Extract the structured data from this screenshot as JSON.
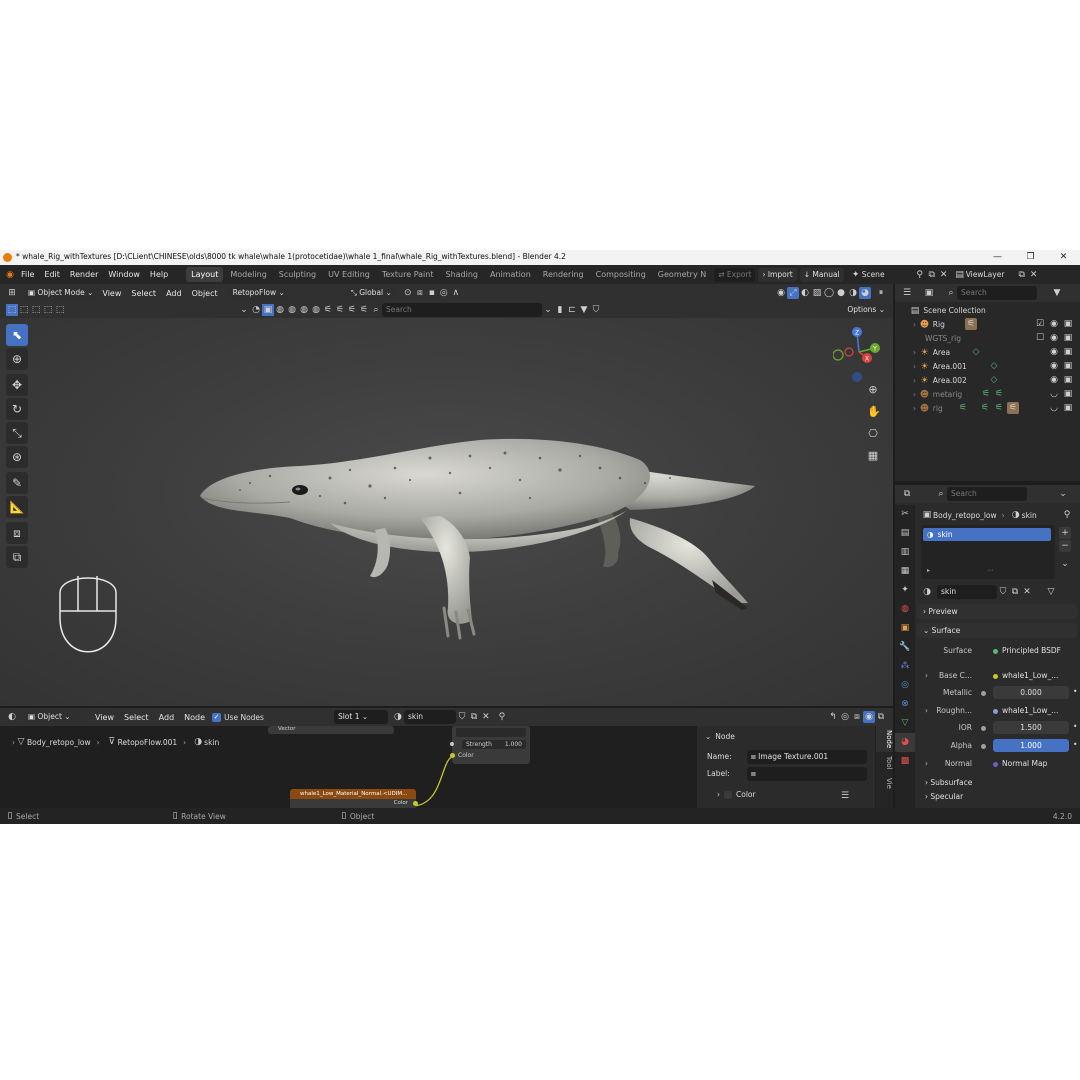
{
  "titlebar": {
    "title": "* whale_Rig_withTextures [D:\\CLient\\CHINESE\\olds\\8000 tk whale\\whale 1(protocetidae)\\whale 1_final\\whale_Rig_withTextures.blend] - Blender 4.2",
    "minimize": "—",
    "maximize": "❐",
    "close": "✕"
  },
  "menu": [
    "File",
    "Edit",
    "Render",
    "Window",
    "Help"
  ],
  "workspaces": [
    "Layout",
    "Modeling",
    "Sculpting",
    "UV Editing",
    "Texture Paint",
    "Shading",
    "Animation",
    "Rendering",
    "Compositing",
    "Geometry N"
  ],
  "topright": {
    "export": "Export",
    "import": "Import",
    "manual": "Manual",
    "scene": "Scene",
    "viewlayer": "ViewLayer"
  },
  "viewport": {
    "mode": "Object Mode",
    "menus": [
      "View",
      "Select",
      "Add",
      "Object"
    ],
    "addon": "RetopoFlow",
    "orientation": "Global",
    "search_placeholder": "Search",
    "options": "Options",
    "gizmo": {
      "z": "Z",
      "y": "Y",
      "x": "X"
    }
  },
  "node_editor": {
    "type": "Object",
    "menus": [
      "View",
      "Select",
      "Add",
      "Node"
    ],
    "use_nodes": "Use Nodes",
    "slot": "Slot 1",
    "material": "skin",
    "breadcrumb": [
      "Body_retopo_low",
      "RetopoFlow.001",
      "skin"
    ],
    "node_vector": "Vector",
    "node_strength_label": "Strength",
    "node_strength_value": "1.000",
    "node_color": "Color",
    "texture_node_title": "whale1_Low_Material_Normal.<UDIM...",
    "texture_node_output": "Color",
    "panel": {
      "title": "Node",
      "name_label": "Name:",
      "name_value": "Image Texture.001",
      "label_label": "Label:",
      "color_section": "Color"
    },
    "vtabs": [
      "Node",
      "Tool",
      "Vie"
    ]
  },
  "statusbar": {
    "select": "Select",
    "rotate": "Rotate View",
    "object": "Object",
    "version": "4.2.0"
  },
  "outliner": {
    "search_placeholder": "Search",
    "root": "Scene Collection",
    "items": [
      {
        "name": "Rig",
        "dim": false
      },
      {
        "name": "WGTS_rig",
        "dim": true
      },
      {
        "name": "Area",
        "dim": false
      },
      {
        "name": "Area.001",
        "dim": false
      },
      {
        "name": "Area.002",
        "dim": false
      },
      {
        "name": "metarig",
        "dim": true
      },
      {
        "name": "rig",
        "dim": true
      }
    ]
  },
  "properties": {
    "search_placeholder": "Search",
    "object": "Body_retopo_low",
    "material": "skin",
    "slot_name": "skin",
    "material_field": "skin",
    "preview": "Preview",
    "surface": "Surface",
    "surface_label": "Surface",
    "surface_value": "Principled BSDF",
    "rows": [
      {
        "label": "Base C...",
        "value": "whale1_Low_...",
        "kind": "link"
      },
      {
        "label": "Metallic",
        "value": "0.000",
        "kind": "num"
      },
      {
        "label": "Roughn...",
        "value": "whale1_Low_...",
        "kind": "link"
      },
      {
        "label": "IOR",
        "value": "1.500",
        "kind": "num"
      },
      {
        "label": "Alpha",
        "value": "1.000",
        "kind": "blue"
      },
      {
        "label": "Normal",
        "value": "Normal Map",
        "kind": "link"
      }
    ],
    "subsurface": "Subsurface",
    "specular": "Specular"
  },
  "colors": {
    "accent": "#4672c4",
    "blender_orange": "#e87d0d",
    "node_orange": "#8a4a12"
  }
}
